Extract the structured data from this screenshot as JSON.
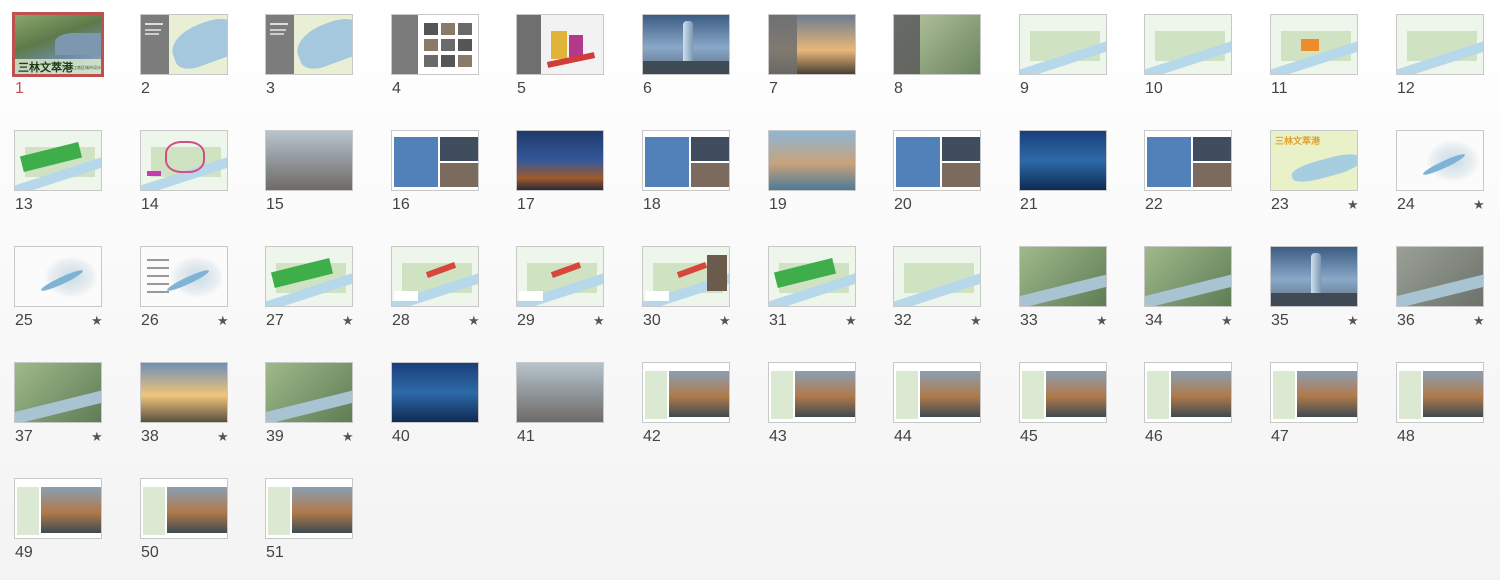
{
  "app": {
    "view": "slide-sorter"
  },
  "selected_slide": 1,
  "colors": {
    "selection": "#c0504d"
  },
  "slides": [
    {
      "number": "1",
      "kind": "cover",
      "title": "三林文萃港",
      "subtitle": "三林滨江南区城市设计",
      "star": false
    },
    {
      "number": "2",
      "kind": "gray-map",
      "star": false
    },
    {
      "number": "3",
      "kind": "gray-map",
      "star": false
    },
    {
      "number": "4",
      "kind": "gray-photos",
      "star": false
    },
    {
      "number": "5",
      "kind": "diagram-3d",
      "star": false
    },
    {
      "number": "6",
      "kind": "tower",
      "star": false
    },
    {
      "number": "7",
      "kind": "gray-dusk",
      "star": false
    },
    {
      "number": "8",
      "kind": "gray-aerial",
      "star": false
    },
    {
      "number": "9",
      "kind": "map",
      "star": false
    },
    {
      "number": "10",
      "kind": "map",
      "star": false
    },
    {
      "number": "11",
      "kind": "map-orange",
      "star": false
    },
    {
      "number": "12",
      "kind": "map",
      "star": false
    },
    {
      "number": "13",
      "kind": "map-green",
      "star": false
    },
    {
      "number": "14",
      "kind": "map-pink",
      "star": false
    },
    {
      "number": "15",
      "kind": "photo-city",
      "star": false
    },
    {
      "number": "16",
      "kind": "blue-photos",
      "star": false
    },
    {
      "number": "17",
      "kind": "photo-night",
      "star": false
    },
    {
      "number": "18",
      "kind": "blue-photos",
      "star": false
    },
    {
      "number": "19",
      "kind": "photo-harbor",
      "star": false
    },
    {
      "number": "20",
      "kind": "blue-photos",
      "star": false
    },
    {
      "number": "21",
      "kind": "photo-blue",
      "star": false
    },
    {
      "number": "22",
      "kind": "blue-photos",
      "star": false
    },
    {
      "number": "23",
      "kind": "title-map",
      "title": "三林文萃港",
      "star": true
    },
    {
      "number": "24",
      "kind": "white-river",
      "star": true
    },
    {
      "number": "25",
      "kind": "white-river",
      "star": true
    },
    {
      "number": "26",
      "kind": "white-river-list",
      "star": true
    },
    {
      "number": "27",
      "kind": "map-green-big",
      "star": true
    },
    {
      "number": "28",
      "kind": "map-red",
      "star": true
    },
    {
      "number": "29",
      "kind": "map-red",
      "star": true
    },
    {
      "number": "30",
      "kind": "map-red-photo",
      "star": true
    },
    {
      "number": "31",
      "kind": "map-green-zone",
      "star": true
    },
    {
      "number": "32",
      "kind": "plan",
      "star": true
    },
    {
      "number": "33",
      "kind": "aerial",
      "star": true
    },
    {
      "number": "34",
      "kind": "aerial",
      "star": true
    },
    {
      "number": "35",
      "kind": "tower",
      "star": true
    },
    {
      "number": "36",
      "kind": "aerial-gray",
      "star": true
    },
    {
      "number": "37",
      "kind": "aerial",
      "star": true
    },
    {
      "number": "38",
      "kind": "sunset",
      "star": true
    },
    {
      "number": "39",
      "kind": "aerial",
      "star": true
    },
    {
      "number": "40",
      "kind": "photo-blue",
      "star": false
    },
    {
      "number": "41",
      "kind": "panorama",
      "star": false
    },
    {
      "number": "42",
      "kind": "plan-photo",
      "star": false
    },
    {
      "number": "43",
      "kind": "plan-photo",
      "star": false
    },
    {
      "number": "44",
      "kind": "plan-photo",
      "star": false
    },
    {
      "number": "45",
      "kind": "plan-photo",
      "star": false
    },
    {
      "number": "46",
      "kind": "plan-photo",
      "star": false
    },
    {
      "number": "47",
      "kind": "plan-photo",
      "star": false
    },
    {
      "number": "48",
      "kind": "plan-photo",
      "star": false
    },
    {
      "number": "49",
      "kind": "plan-photo",
      "star": false
    },
    {
      "number": "50",
      "kind": "plan-photo",
      "star": false
    },
    {
      "number": "51",
      "kind": "plan-photo",
      "star": false
    }
  ]
}
